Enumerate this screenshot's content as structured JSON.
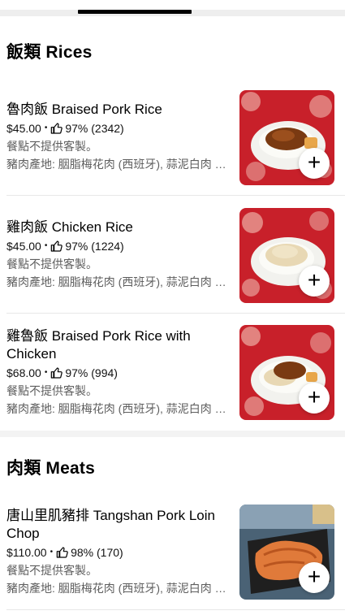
{
  "sections": [
    {
      "title": "飯類 Rices",
      "items": [
        {
          "name": "魯肉飯 Braised Pork Rice",
          "price": "$45.00",
          "rating": "97% (2342)",
          "note": "餐點不提供客製。",
          "desc": "豬肉產地: 胭脂梅花肉 (西班牙), 蒜泥白肉 (台灣)"
        },
        {
          "name": "雞肉飯 Chicken Rice",
          "price": "$45.00",
          "rating": "97% (1224)",
          "note": "餐點不提供客製。",
          "desc": "豬肉產地: 胭脂梅花肉 (西班牙), 蒜泥白肉 (台灣)"
        },
        {
          "name": "雞魯飯 Braised Pork Rice with Chicken",
          "price": "$68.00",
          "rating": "97% (994)",
          "note": "餐點不提供客製。",
          "desc": "豬肉產地: 胭脂梅花肉 (西班牙), 蒜泥白肉 (台灣)"
        }
      ]
    },
    {
      "title": "肉類 Meats",
      "items": [
        {
          "name": "唐山里肌豬排 Tangshan Pork Loin Chop",
          "price": "$110.00",
          "rating": "98% (170)",
          "note": "餐點不提供客製。",
          "desc": "豬肉產地: 胭脂梅花肉 (西班牙), 蒜泥白肉 (台灣)"
        }
      ]
    }
  ],
  "separator": "•",
  "add_label": "+",
  "icons": {
    "rating": "thumbs-up-icon",
    "add": "plus-icon"
  },
  "colors": {
    "accent_red": "#c8202a",
    "secondary_text": "#5e5e5e"
  }
}
